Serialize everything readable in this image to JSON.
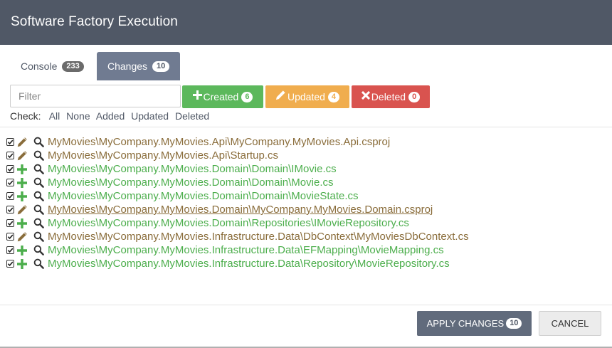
{
  "header": {
    "title": "Software Factory Execution"
  },
  "tabs": [
    {
      "label": "Console",
      "count": "233"
    },
    {
      "label": "Changes",
      "count": "10"
    }
  ],
  "filter": {
    "placeholder": "Filter",
    "value": ""
  },
  "filter_buttons": {
    "created": {
      "label": "Created",
      "count": "6"
    },
    "updated": {
      "label": "Updated",
      "count": "4"
    },
    "deleted": {
      "label": "Deleted",
      "count": "0"
    }
  },
  "check": {
    "label": "Check:",
    "options": [
      "All",
      "None",
      "Added",
      "Updated",
      "Deleted"
    ]
  },
  "files": [
    {
      "action": "updated",
      "path": "MyMovies\\MyCompany.MyMovies.Api\\MyCompany.MyMovies.Api.csproj"
    },
    {
      "action": "updated",
      "path": "MyMovies\\MyCompany.MyMovies.Api\\Startup.cs"
    },
    {
      "action": "created",
      "path": "MyMovies\\MyCompany.MyMovies.Domain\\Domain\\IMovie.cs"
    },
    {
      "action": "created",
      "path": "MyMovies\\MyCompany.MyMovies.Domain\\Domain\\Movie.cs"
    },
    {
      "action": "created",
      "path": "MyMovies\\MyCompany.MyMovies.Domain\\Domain\\MovieState.cs"
    },
    {
      "action": "updated",
      "path": "MyMovies\\MyCompany.MyMovies.Domain\\MyCompany.MyMovies.Domain.csproj",
      "hovered": true
    },
    {
      "action": "created",
      "path": "MyMovies\\MyCompany.MyMovies.Domain\\Repositories\\IMovieRepository.cs"
    },
    {
      "action": "updated",
      "path": "MyMovies\\MyCompany.MyMovies.Infrastructure.Data\\DbContext\\MyMoviesDbContext.cs"
    },
    {
      "action": "created",
      "path": "MyMovies\\MyCompany.MyMovies.Infrastructure.Data\\EFMapping\\MovieMapping.cs"
    },
    {
      "action": "created",
      "path": "MyMovies\\MyCompany.MyMovies.Infrastructure.Data\\Repository\\MovieRepository.cs"
    }
  ],
  "footer": {
    "apply_label": "APPLY CHANGES",
    "apply_count": "10",
    "cancel_label": "CANCEL"
  },
  "colors": {
    "header_bg": "#505866",
    "created": "#5cb85c",
    "updated": "#f0ad4e",
    "deleted": "#d9534f",
    "created_text": "#4cae4c",
    "updated_text": "#8a6d3b"
  }
}
